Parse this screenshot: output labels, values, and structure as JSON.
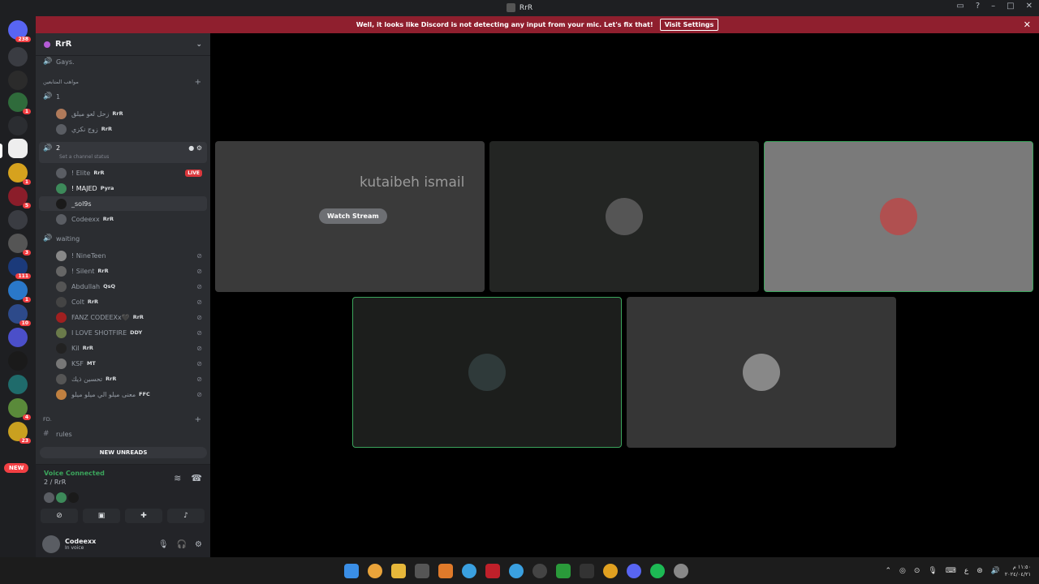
{
  "window": {
    "title": "RrR"
  },
  "banner": {
    "message": "Well, it looks like Discord is not detecting any input from your mic. Let's fix that!",
    "button": "Visit Settings"
  },
  "servers": {
    "badges": [
      "238",
      "1",
      "1",
      "5",
      "3",
      "111",
      "1",
      "10",
      "4",
      "23"
    ],
    "new_label": "NEW"
  },
  "guild": {
    "name": "RrR"
  },
  "channels": {
    "top": "Gays.",
    "cat1": "مواهب المتابعين",
    "vc1": "1",
    "vc1_users": [
      {
        "name": "زحل لعو ميلق",
        "tag": "RrR"
      },
      {
        "name": "زوج نكزي",
        "tag": "RrR"
      }
    ],
    "vc2": "2",
    "vc2_status": "Set a channel status",
    "vc2_users": [
      {
        "name": "! Elite",
        "tag": "RrR"
      },
      {
        "name": "! MAJED",
        "tag": "Pyra"
      },
      {
        "name": "_sol9s",
        "tag": ""
      },
      {
        "name": "Codeexx",
        "tag": "RrR"
      }
    ],
    "live": "LIVE",
    "waiting": "waiting",
    "waiting_users": [
      {
        "name": "! NineTeen",
        "tag": ""
      },
      {
        "name": "! Silent",
        "tag": "RrR"
      },
      {
        "name": "Abdullah",
        "tag": "QsQ"
      },
      {
        "name": "Colt",
        "tag": "RrR"
      },
      {
        "name": "FANZ CODEEXx🖤",
        "tag": "RrR"
      },
      {
        "name": "I LOVE SHOTFIRE",
        "tag": "DDY"
      },
      {
        "name": "Kil",
        "tag": "RrR"
      },
      {
        "name": "KSF",
        "tag": "MT"
      },
      {
        "name": "تحسين ذيك",
        "tag": "RrR"
      },
      {
        "name": "معنى ميلو الي ميلو ميلو",
        "tag": "FFC"
      }
    ],
    "cat2": "FD.",
    "rules": "rules",
    "new_unreads": "NEW UNREADS"
  },
  "voice": {
    "status": "Voice Connected",
    "channel": "2 / RrR"
  },
  "user": {
    "name": "Codeexx",
    "status": "In voice"
  },
  "stage": {
    "stream_title": "kutaibeh ismail",
    "watch_button": "Watch Stream"
  },
  "clock": {
    "time": "١١:٥٠ م",
    "date": "٢٠٢٤/٠٤/٢١"
  },
  "tray": {
    "lang": "ع"
  }
}
